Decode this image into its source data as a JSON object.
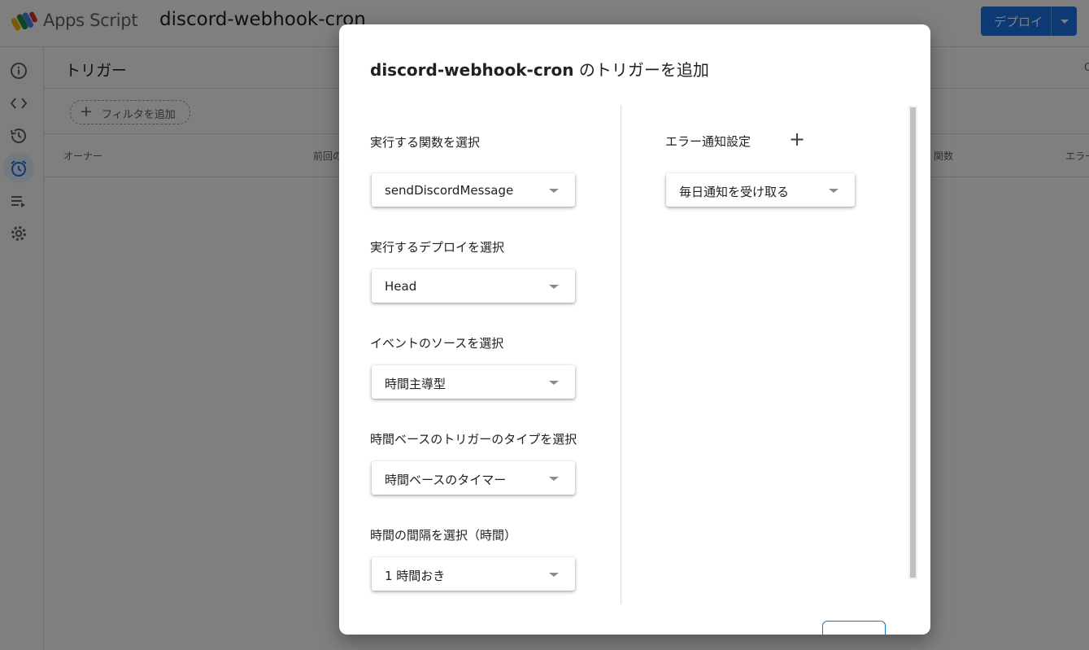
{
  "app": {
    "brand": "Apps Script",
    "project_title": "discord-webhook-cron",
    "deploy_label": "デプロイ"
  },
  "rail": {
    "icons": [
      "info-icon",
      "code-icon",
      "history-icon",
      "alarm-icon",
      "executions-icon",
      "settings-icon"
    ],
    "active": "alarm-icon"
  },
  "main": {
    "title": "トリガー",
    "filter_label": "フィルタを追加",
    "columns": [
      "オーナー",
      "前回の",
      "関数",
      "エラー"
    ],
    "right_edge_char": "C"
  },
  "dialog": {
    "title_name": "discord-webhook-cron",
    "title_suffix": " のトリガーを追加",
    "fields": [
      {
        "label": "実行する関数を選択",
        "value": "sendDiscordMessage"
      },
      {
        "label": "実行するデプロイを選択",
        "value": "Head"
      },
      {
        "label": "イベントのソースを選択",
        "value": "時間主導型"
      },
      {
        "label": "時間ベースのトリガーのタイプを選択",
        "value": "時間ベースのタイマー"
      },
      {
        "label": "時間の間隔を選択（時間）",
        "value": "1 時間おき"
      }
    ],
    "error_notification": {
      "label": "エラー通知設定",
      "add_symbol": "+",
      "value": "毎日通知を受け取る"
    }
  },
  "colors": {
    "accent": "#1a73e8",
    "scrim": "rgba(0,0,0,0.5)"
  }
}
